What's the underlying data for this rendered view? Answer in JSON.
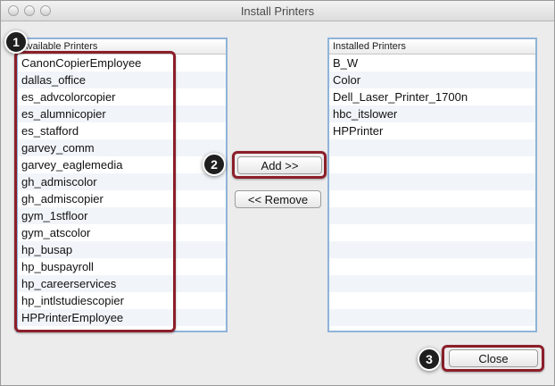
{
  "window": {
    "title": "Install Printers"
  },
  "available": {
    "header": "Available Printers",
    "items": [
      "CanonCopierEmployee",
      "dallas_office",
      "es_advcolorcopier",
      "es_alumnicopier",
      "es_stafford",
      "garvey_comm",
      "garvey_eaglemedia",
      "gh_admiscolor",
      "gh_admiscopier",
      "gym_1stfloor",
      "gym_atscolor",
      "hp_busap",
      "hp_buspayroll",
      "hp_careerservices",
      "hp_intlstudiescopier",
      "HPPrinterEmployee"
    ]
  },
  "installed": {
    "header": "Installed Printers",
    "items": [
      "B_W",
      "Color",
      "Dell_Laser_Printer_1700n",
      "hbc_itslower",
      "HPPrinter"
    ]
  },
  "buttons": {
    "add": "Add >>",
    "remove": "<< Remove",
    "close": "Close"
  },
  "badges": {
    "one": "1",
    "two": "2",
    "three": "3"
  },
  "colors": {
    "highlight": "#8b1f2a",
    "list_border": "#8fb3d8",
    "badge": "#1e1e1e"
  }
}
